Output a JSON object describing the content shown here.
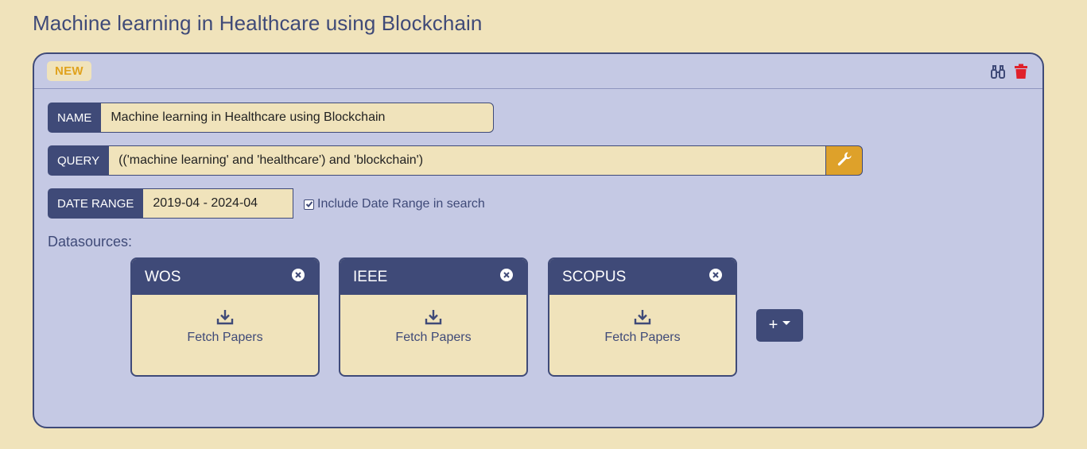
{
  "page": {
    "title": "Machine learning in Healthcare using Blockchain"
  },
  "card": {
    "badge": "NEW",
    "icons": [
      "binoculars-icon",
      "trash-icon"
    ],
    "name": {
      "label": "NAME",
      "value": "Machine learning in Healthcare using Blockchain"
    },
    "query": {
      "label": "QUERY",
      "value": "(('machine learning' and 'healthcare') and 'blockchain')",
      "action_icon": "wrench-icon"
    },
    "date_range": {
      "label": "DATE RANGE",
      "value": "2019-04 - 2024-04",
      "include_label": "Include Date Range in search",
      "include_checked": true
    },
    "datasources_title": "Datasources:",
    "datasources": [
      {
        "name": "WOS",
        "action": "Fetch Papers"
      },
      {
        "name": "IEEE",
        "action": "Fetch Papers"
      },
      {
        "name": "SCOPUS",
        "action": "Fetch Papers"
      }
    ],
    "add_button": "+"
  },
  "colors": {
    "background": "#f0e3bb",
    "card": "#c5c9e4",
    "primary": "#3f4a78",
    "accent": "#dea12a",
    "badge_text": "#e0a21e",
    "danger": "#e0202a"
  }
}
